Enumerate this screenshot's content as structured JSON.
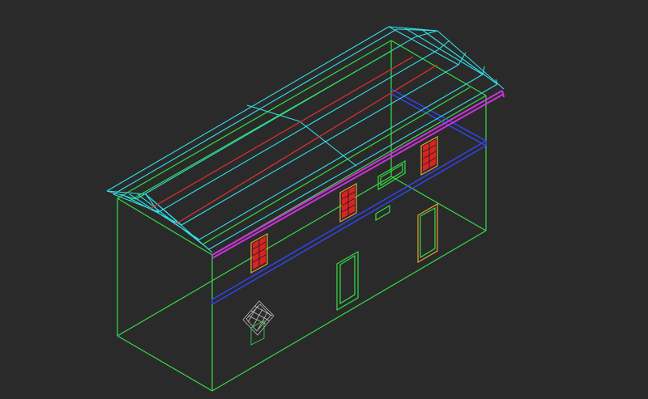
{
  "viewport": {
    "view": "3D wireframe",
    "background": "#2a2a2a"
  },
  "colors": {
    "walls": "#33dd44",
    "roof": "#33e0e8",
    "ridge": "#e03030",
    "eave": "#cc33dd",
    "floor_beam": "#3344ee",
    "windows": "#ff3333",
    "window_frame": "#e8a030",
    "door": "#33dd44",
    "vent_grille": "#bbbbbb"
  },
  "objects": [
    {
      "name": "exterior-walls",
      "color": "walls"
    },
    {
      "name": "hip-roof",
      "color": "roof"
    },
    {
      "name": "roof-ridge",
      "color": "ridge"
    },
    {
      "name": "eave-trim",
      "color": "eave"
    },
    {
      "name": "floor-beam",
      "color": "floor_beam"
    },
    {
      "name": "upper-windows",
      "color": "windows"
    },
    {
      "name": "doors",
      "color": "door"
    },
    {
      "name": "vent-grille",
      "color": "vent_grille"
    }
  ]
}
